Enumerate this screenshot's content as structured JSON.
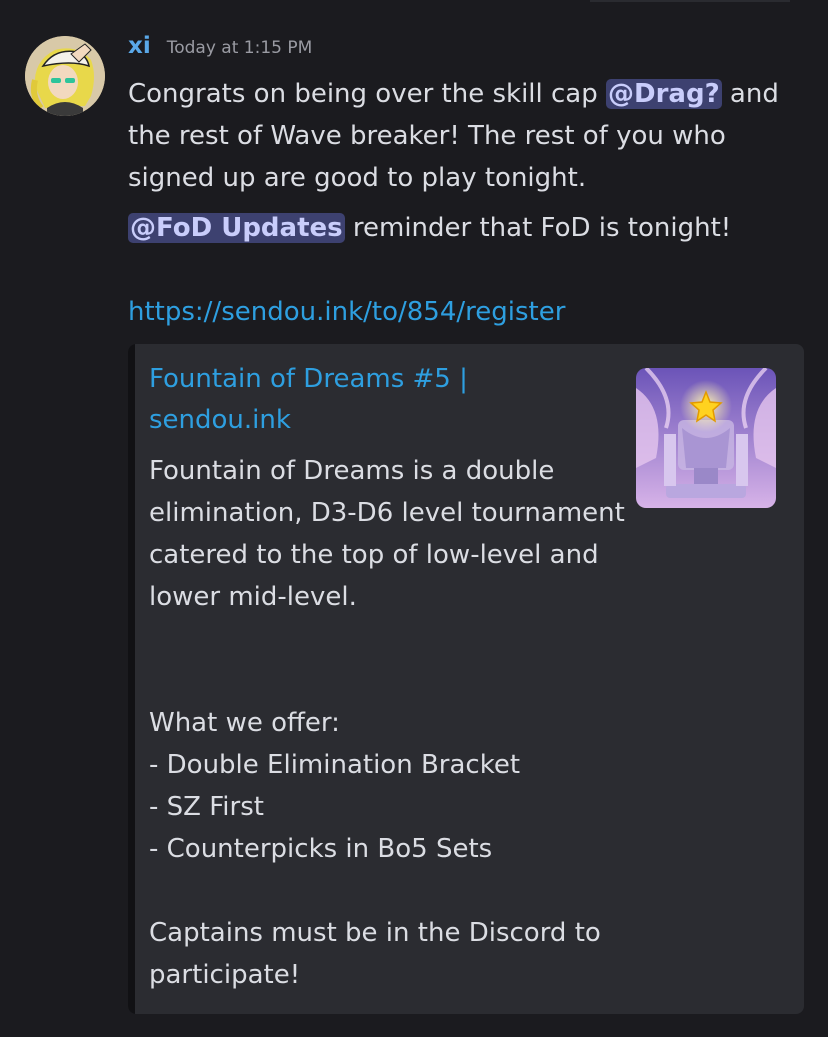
{
  "message": {
    "username": "xi",
    "timestamp": "Today at 1:15 PM",
    "p1_before": "Congrats on being over the skill cap ",
    "mention_drag": "@Drag?",
    "p1_after": " and the rest of Wave breaker! The rest of you who signed up are good to play tonight.",
    "mention_fod": "@FoD Updates",
    "p2_after": " reminder that FoD is tonight!",
    "link": "https://sendou.ink/to/854/register"
  },
  "embed": {
    "title_line1": "Fountain of Dreams #5 |",
    "title_line2": "sendou.ink",
    "description": "Fountain of Dreams is a double elimination, D3-D6 level tournament catered to the top of low-level and lower mid-level.\n\n\nWhat we offer:\n- Double Elimination Bracket\n- SZ First\n- Counterpicks in Bo5 Sets\n\nCaptains must be in the Discord to participate!"
  },
  "colors": {
    "background": "#1b1b1f",
    "username": "#5aa8e8",
    "link": "#2e9fe0",
    "mention_bg": "#3d4170",
    "embed_bg": "#2b2c31"
  }
}
